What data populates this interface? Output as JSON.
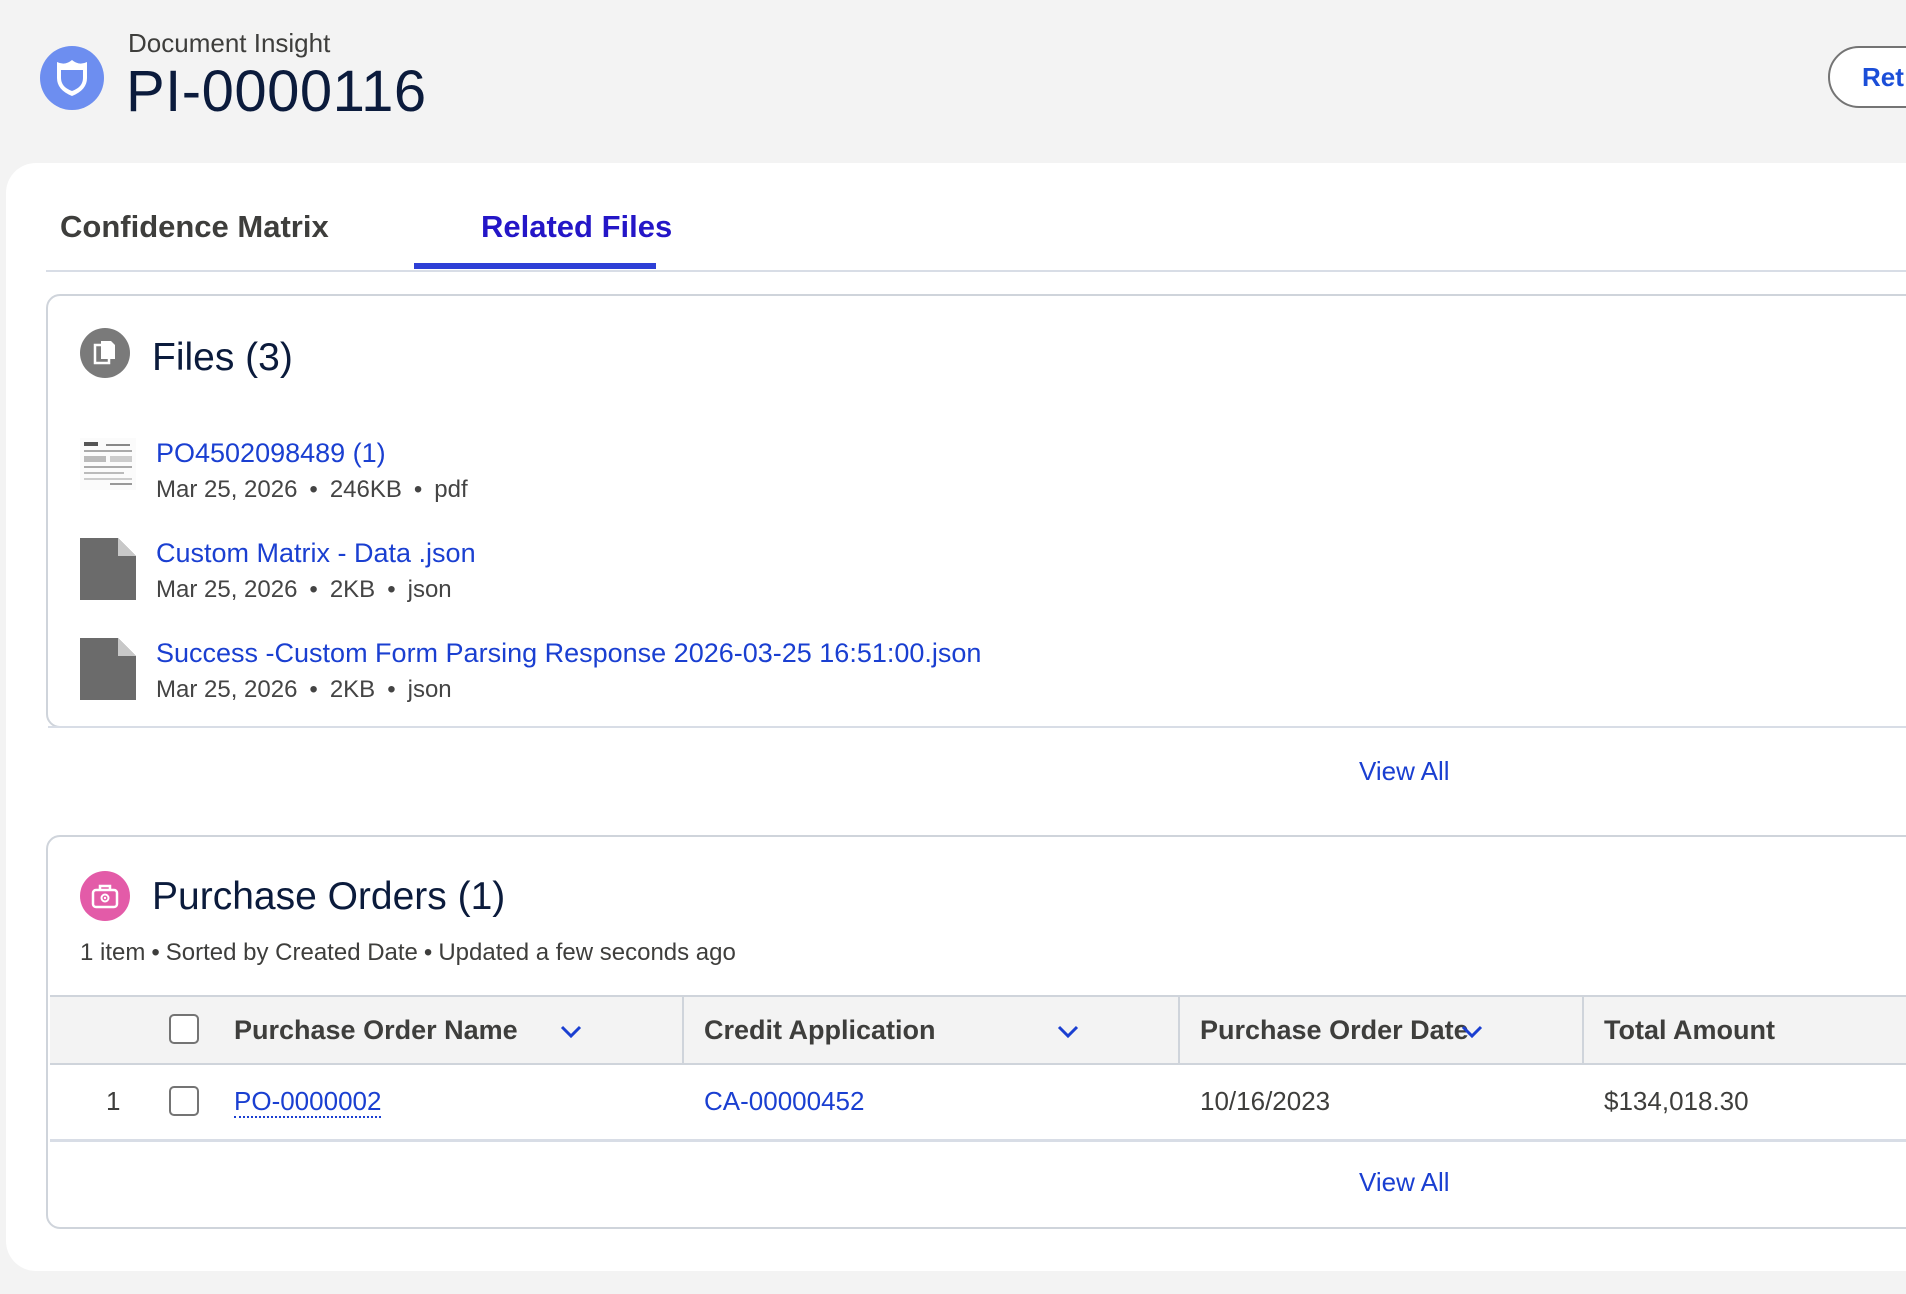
{
  "header": {
    "object_label": "Document Insight",
    "record_name": "PI-0000116",
    "action_button_label": "Ret",
    "icon": "shield-icon",
    "icon_color": "#6d8ef0"
  },
  "tabs": [
    {
      "label": "Confidence Matrix",
      "active": false
    },
    {
      "label": "Related Files",
      "active": true
    }
  ],
  "files_card": {
    "title": "Files (3)",
    "icon": "files-icon",
    "icon_color": "#7a7a7a",
    "files": [
      {
        "name": "PO4502098489 (1)",
        "date": "Mar 25, 2026",
        "size": "246KB",
        "type": "pdf",
        "thumb": "pdf-thumbnail"
      },
      {
        "name": "Custom Matrix - Data .json",
        "date": "Mar 25, 2026",
        "size": "2KB",
        "type": "json",
        "thumb": "file-icon"
      },
      {
        "name": "Success -Custom Form Parsing Response 2026-03-25 16:51:00.json",
        "date": "Mar 25, 2026",
        "size": "2KB",
        "type": "json",
        "thumb": "file-icon"
      }
    ],
    "view_all": "View All"
  },
  "po_card": {
    "title": "Purchase Orders (1)",
    "icon": "briefcase-icon",
    "icon_color": "#e35ba8",
    "meta": {
      "count": "1 item",
      "sorted": "Sorted by Created Date",
      "updated": "Updated a few seconds ago"
    },
    "columns": [
      "Purchase Order Name",
      "Credit Application",
      "Purchase Order Date",
      "Total Amount"
    ],
    "rows": [
      {
        "index": "1",
        "name": "PO-0000002",
        "credit_application": "CA-00000452",
        "date": "10/16/2023",
        "amount": "$134,018.30"
      }
    ],
    "view_all": "View All"
  },
  "colors": {
    "link": "#1a3fd1",
    "active_tab": "#2416c7",
    "title": "#0b1b3c"
  }
}
